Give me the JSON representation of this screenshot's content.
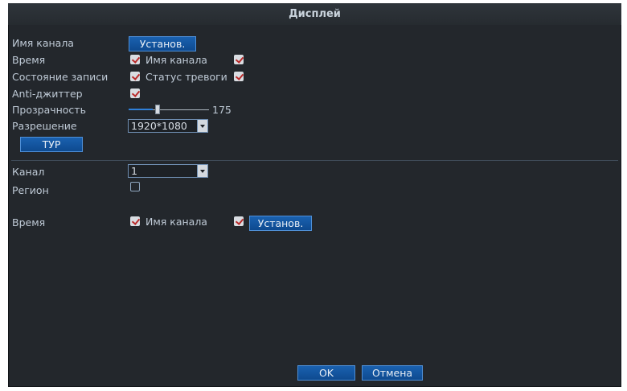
{
  "window": {
    "title": "Дисплей"
  },
  "section1": {
    "channel_name_label": "Имя канала",
    "channel_name_button": "Установ.",
    "time_label": "Время",
    "time_checked": true,
    "channel_name_inline_label": "Имя канала",
    "channel_name_inline_checked": true,
    "record_state_label": "Состояние записи",
    "record_state_checked": true,
    "alarm_status_label": "Статус тревоги",
    "alarm_status_checked": true,
    "anti_jitter_label": "Anti-джиттер",
    "anti_jitter_checked": true,
    "transparency_label": "Прозрачность",
    "transparency_value": "175",
    "transparency_fraction": 0.3,
    "resolution_label": "Разрешение",
    "resolution_value": "1920*1080",
    "tour_button": "ТУР"
  },
  "section2": {
    "channel_label": "Канал",
    "channel_value": "1",
    "region_label": "Регион",
    "region_checked": false,
    "time_label": "Время",
    "time_checked": true,
    "channel_name_label": "Имя канала",
    "channel_name_checked": true,
    "set_button": "Установ."
  },
  "footer": {
    "ok_button": "OK",
    "cancel_button": "Отмена"
  },
  "colors": {
    "panel_bg": "#23272c",
    "button_blue": "#0e4a8f",
    "accent_red_check": "#b92a2a"
  }
}
